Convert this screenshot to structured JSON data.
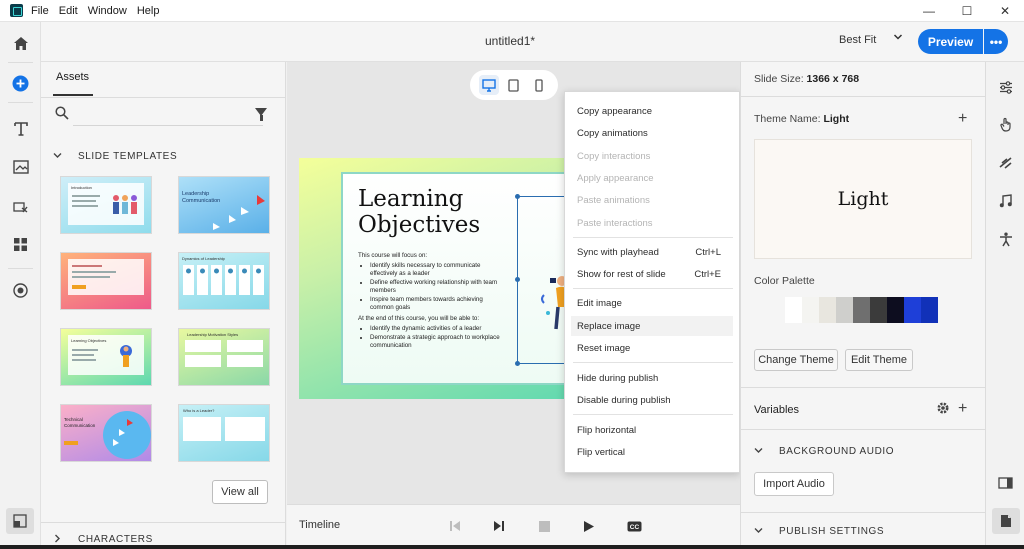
{
  "menubar": {
    "items": [
      "File",
      "Edit",
      "Window",
      "Help"
    ],
    "controls": {
      "minimize": "—",
      "maximize": "☐",
      "close": "✕"
    }
  },
  "header": {
    "title": "untitled1*",
    "fit": "Best Fit",
    "preview_label": "Preview",
    "more_label": "•••"
  },
  "assets": {
    "tab_label": "Assets",
    "search_placeholder": "",
    "section_slide_templates": "SLIDE TEMPLATES",
    "view_all_label": "View all",
    "section_characters": "CHARACTERS",
    "templates": [
      {
        "title": "Introduction",
        "bg": "#9fe6f2"
      },
      {
        "title": "Leadership Communication",
        "bg": "#8fcaf0"
      },
      {
        "title": "",
        "bg": "#f07a8a"
      },
      {
        "title": "Dynamics of Leadership",
        "bg": "#a8e8ee"
      },
      {
        "title": "Learning Objectives",
        "bg": "#c9f0a8"
      },
      {
        "title": "Leadership Motivation Styles",
        "bg": "#c9f0a8"
      },
      {
        "title": "Technical Communication",
        "bg": "#f6a9c9"
      },
      {
        "title": "Who is a Leader?",
        "bg": "#9fe6f2"
      }
    ]
  },
  "slide": {
    "title": "Learning Objectives",
    "intro": "This course will focus on:",
    "bullets1": [
      "Identify skills necessary to communicate effectively as a leader",
      "Define effective working relationship with team members",
      "Inspire team members towards achieving common goals"
    ],
    "intro2": "At the end of this course, you will be able to:",
    "bullets2": [
      "Identify the dynamic activities of a leader",
      "Demonstrate a strategic approach to workplace communication"
    ]
  },
  "timeline": {
    "label": "Timeline"
  },
  "context_menu": {
    "items": [
      {
        "label": "Copy appearance",
        "enabled": true
      },
      {
        "label": "Copy animations",
        "enabled": true
      },
      {
        "label": "Copy interactions",
        "enabled": false
      },
      {
        "label": "Apply appearance",
        "enabled": false
      },
      {
        "label": "Paste animations",
        "enabled": false
      },
      {
        "label": "Paste interactions",
        "enabled": false
      },
      {
        "label": "Sync with playhead",
        "enabled": true,
        "shortcut": "Ctrl+L"
      },
      {
        "label": "Show for rest of slide",
        "enabled": true,
        "shortcut": "Ctrl+E"
      },
      {
        "label": "Edit image",
        "enabled": true
      },
      {
        "label": "Replace image",
        "enabled": true,
        "hover": true
      },
      {
        "label": "Reset image",
        "enabled": true
      },
      {
        "label": "Hide during publish",
        "enabled": true
      },
      {
        "label": "Disable during publish",
        "enabled": true
      },
      {
        "label": "Flip horizontal",
        "enabled": true
      },
      {
        "label": "Flip vertical",
        "enabled": true
      }
    ]
  },
  "properties": {
    "slide_size_label": "Slide Size:",
    "slide_size_value": "1366 x 768",
    "theme_name_label": "Theme Name:",
    "theme_name_value": "Light",
    "theme_preview_text": "Light",
    "color_palette_label": "Color Palette",
    "palette": [
      "#ffffff",
      "#f4f4f1",
      "#e8e6df",
      "#cfcfcc",
      "#6f6f6f",
      "#3b3b3b",
      "#0d0d1f",
      "#1e3fd8",
      "#1131b8"
    ],
    "change_theme_label": "Change Theme",
    "edit_theme_label": "Edit Theme",
    "variables_label": "Variables",
    "background_audio_label": "BACKGROUND AUDIO",
    "import_audio_label": "Import Audio",
    "publish_settings_label": "PUBLISH SETTINGS"
  },
  "colors": {
    "accent": "#1473e6",
    "selection": "#2a6db0"
  }
}
